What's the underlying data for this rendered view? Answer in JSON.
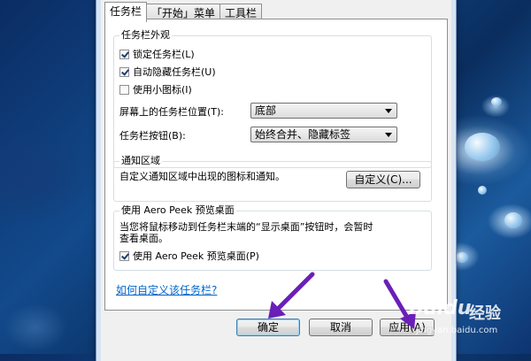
{
  "tabs": [
    {
      "label": "任务栏"
    },
    {
      "label": "「开始」菜单"
    },
    {
      "label": "工具栏"
    }
  ],
  "appearance": {
    "title": "任务栏外观",
    "lock_label": "锁定任务栏(L)",
    "autohide_label": "自动隐藏任务栏(U)",
    "small_icons_label": "使用小图标(I)",
    "position_label": "屏幕上的任务栏位置(T):",
    "position_value": "底部",
    "buttons_label": "任务栏按钮(B):",
    "buttons_value": "始终合并、隐藏标签"
  },
  "notify": {
    "title": "通知区域",
    "desc": "自定义通知区域中出现的图标和通知。",
    "customize_button": "自定义(C)..."
  },
  "peek": {
    "title": "使用 Aero Peek 预览桌面",
    "desc_line1": "当您将鼠标移动到任务栏末端的“显示桌面”按钮时，会暂时",
    "desc_line2": "查看桌面。",
    "checkbox_label": "使用 Aero Peek 预览桌面(P)"
  },
  "help_link": "如何自定义该任务栏?",
  "buttons": {
    "ok": "确定",
    "cancel": "取消",
    "apply": "应用(A)"
  },
  "watermark": {
    "brand": "Baidu",
    "suffix": "经验",
    "url": "jingyan.baidu.com"
  }
}
